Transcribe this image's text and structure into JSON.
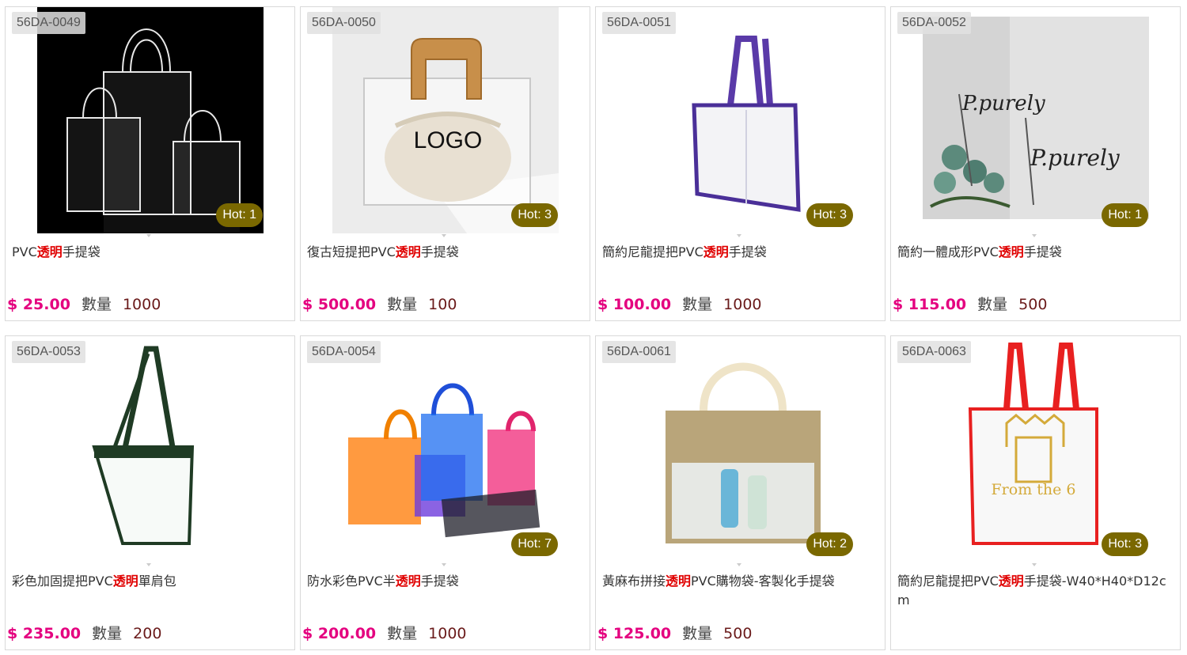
{
  "products": [
    {
      "code": "56DA-0049",
      "hot": "Hot: 1",
      "title_pre": "PVC",
      "title_hl": "透明",
      "title_post": "手提袋",
      "price": "$ 25.00",
      "qty_label": "數量",
      "qty": "1000",
      "image_icon": "clear-pvc-bags-photo"
    },
    {
      "code": "56DA-0050",
      "hot": "Hot: 3",
      "title_pre": "復古短提把PVC",
      "title_hl": "透明",
      "title_post": "手提袋",
      "price": "$ 500.00",
      "qty_label": "數量",
      "qty": "100",
      "image_icon": "wooden-handle-bag-photo",
      "image_text": "LOGO"
    },
    {
      "code": "56DA-0051",
      "hot": "Hot: 3",
      "title_pre": "簡約尼龍提把PVC",
      "title_hl": "透明",
      "title_post": "手提袋",
      "price": "$ 100.00",
      "qty_label": "數量",
      "qty": "1000",
      "image_icon": "purple-trim-bag-photo"
    },
    {
      "code": "56DA-0052",
      "hot": "Hot: 1",
      "title_pre": "簡約一體成形PVC",
      "title_hl": "透明",
      "title_post": "手提袋",
      "price": "$ 115.00",
      "qty_label": "數量",
      "qty": "500",
      "image_icon": "ppurely-bag-photo"
    },
    {
      "code": "56DA-0053",
      "hot": "",
      "title_pre": "彩色加固提把PVC",
      "title_hl": "透明",
      "title_post": "單肩包",
      "price": "$ 235.00",
      "qty_label": "數量",
      "qty": "200",
      "image_icon": "green-trim-bag-photo"
    },
    {
      "code": "56DA-0054",
      "hot": "Hot: 7",
      "title_pre": "防水彩色PVC半",
      "title_hl": "透明",
      "title_post": "手提袋",
      "price": "$ 200.00",
      "qty_label": "數量",
      "qty": "1000",
      "image_icon": "colorful-bags-photo"
    },
    {
      "code": "56DA-0061",
      "hot": "Hot: 2",
      "title_pre": "黃麻布拼接",
      "title_hl": "透明",
      "title_post": "PVC購物袋-客製化手提袋",
      "price": "$ 125.00",
      "qty_label": "數量",
      "qty": "500",
      "image_icon": "jute-window-bag-photo"
    },
    {
      "code": "56DA-0063",
      "hot": "Hot: 3",
      "title_pre": "簡約尼龍提把PVC",
      "title_hl": "透明",
      "title_post": "手提袋-W40*H40*D12cm",
      "price": "",
      "qty_label": "",
      "qty": "",
      "image_icon": "red-trim-bag-photo",
      "image_text": "From the 6"
    }
  ],
  "colors": {
    "price": "#e4007f",
    "highlight": "#e00000",
    "hot_badge": "#7a6800",
    "qty_value": "#6a1a1a"
  }
}
